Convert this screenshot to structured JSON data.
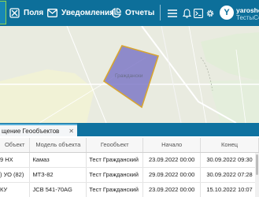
{
  "nav": {
    "items": [
      {
        "label": "Поля",
        "icon": "field-x-icon"
      },
      {
        "label": "Уведомления",
        "icon": "mail-icon"
      },
      {
        "label": "Отчеты",
        "icon": "reports-icon"
      }
    ],
    "icons": [
      "hamburger-menu-icon",
      "bell-icon",
      "terminal-icon",
      "gear-icon"
    ]
  },
  "user": {
    "avatar_letter": "Y",
    "name": "yaroshe",
    "org": "ТестыСо"
  },
  "map": {
    "geofence_label": "Граждански",
    "geofence_color": "#7a74c4"
  },
  "panel": {
    "tab_label": "щение Геообъектов",
    "columns": [
      "Объект",
      "Модель объекта",
      "Геообъект",
      "Начало",
      "Конец"
    ],
    "rows": [
      [
        "9 HX",
        "Камаз",
        "Тест Гражданский",
        "23.09.2022 00:00",
        "30.09.2022 09:30"
      ],
      [
        ") УО (82)",
        "МТЗ-82",
        "Тест Гражданский",
        "29.09.2022 00:00",
        "30.09.2022 07:28"
      ],
      [
        " КУ",
        "JCB 541-70AG",
        "Тест Гражданский",
        "23.09.2022 00:00",
        "15.10.2022 10:07"
      ]
    ]
  },
  "colors": {
    "topbar": "#0d6f9a",
    "accent": "#8fd44c"
  }
}
